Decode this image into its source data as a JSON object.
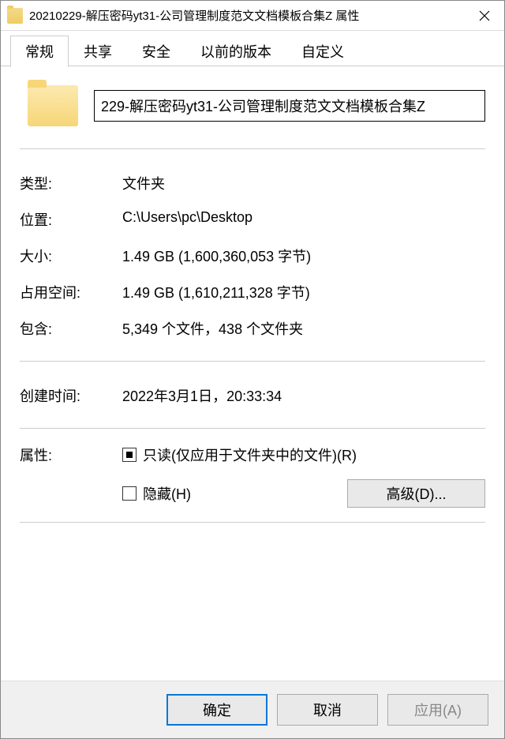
{
  "titlebar": {
    "title": "20210229-解压密码yt31-公司管理制度范文文档模板合集Z 属性"
  },
  "tabs": [
    {
      "label": "常规",
      "active": true
    },
    {
      "label": "共享",
      "active": false
    },
    {
      "label": "安全",
      "active": false
    },
    {
      "label": "以前的版本",
      "active": false
    },
    {
      "label": "自定义",
      "active": false
    }
  ],
  "name_field": {
    "value": "229-解压密码yt31-公司管理制度范文文档模板合集Z"
  },
  "info": {
    "type_label": "类型:",
    "type_value": "文件夹",
    "location_label": "位置:",
    "location_value": "C:\\Users\\pc\\Desktop",
    "size_label": "大小:",
    "size_value": "1.49 GB (1,600,360,053 字节)",
    "size_on_disk_label": "占用空间:",
    "size_on_disk_value": "1.49 GB (1,610,211,328 字节)",
    "contains_label": "包含:",
    "contains_value": "5,349 个文件，438 个文件夹",
    "created_label": "创建时间:",
    "created_value": "2022年3月1日，20:33:34"
  },
  "attributes": {
    "label": "属性:",
    "readonly_label": "只读(仅应用于文件夹中的文件)(R)",
    "hidden_label": "隐藏(H)",
    "advanced_label": "高级(D)..."
  },
  "buttons": {
    "ok": "确定",
    "cancel": "取消",
    "apply": "应用(A)"
  }
}
